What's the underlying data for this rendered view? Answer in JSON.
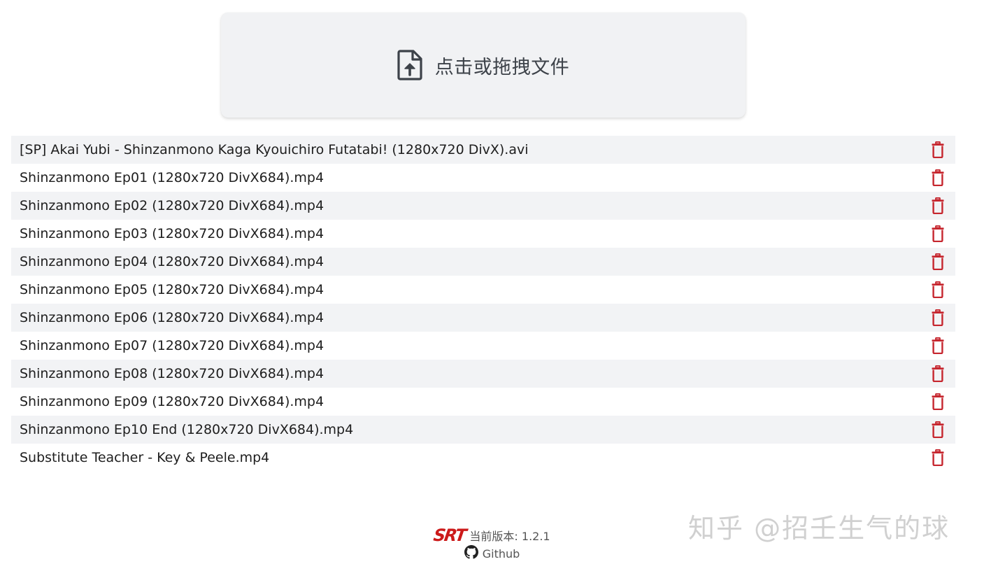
{
  "dropzone": {
    "label": "点击或拖拽文件",
    "icon": "file-upload-icon"
  },
  "files": [
    "[SP] Akai Yubi - Shinzanmono Kaga Kyouichiro Futatabi! (1280x720 DivX).avi",
    "Shinzanmono Ep01 (1280x720 DivX684).mp4",
    "Shinzanmono Ep02 (1280x720 DivX684).mp4",
    "Shinzanmono Ep03 (1280x720 DivX684).mp4",
    "Shinzanmono Ep04 (1280x720 DivX684).mp4",
    "Shinzanmono Ep05 (1280x720 DivX684).mp4",
    "Shinzanmono Ep06 (1280x720 DivX684).mp4",
    "Shinzanmono Ep07 (1280x720 DivX684).mp4",
    "Shinzanmono Ep08 (1280x720 DivX684).mp4",
    "Shinzanmono Ep09 (1280x720 DivX684).mp4",
    "Shinzanmono Ep10 End (1280x720 DivX684).mp4",
    "Substitute Teacher - Key & Peele.mp4"
  ],
  "delete_icon": "trash-icon",
  "footer": {
    "logo": "SRT",
    "version_label": "当前版本: 1.2.1",
    "github_label": "Github",
    "github_icon": "github-icon"
  },
  "watermark": "知乎 @招壬生气的球",
  "colors": {
    "accent_red": "#c6262e",
    "row_stripe": "#f2f3f5",
    "dropzone_bg": "#f1f2f4",
    "logo_red": "#cc1a1a"
  }
}
